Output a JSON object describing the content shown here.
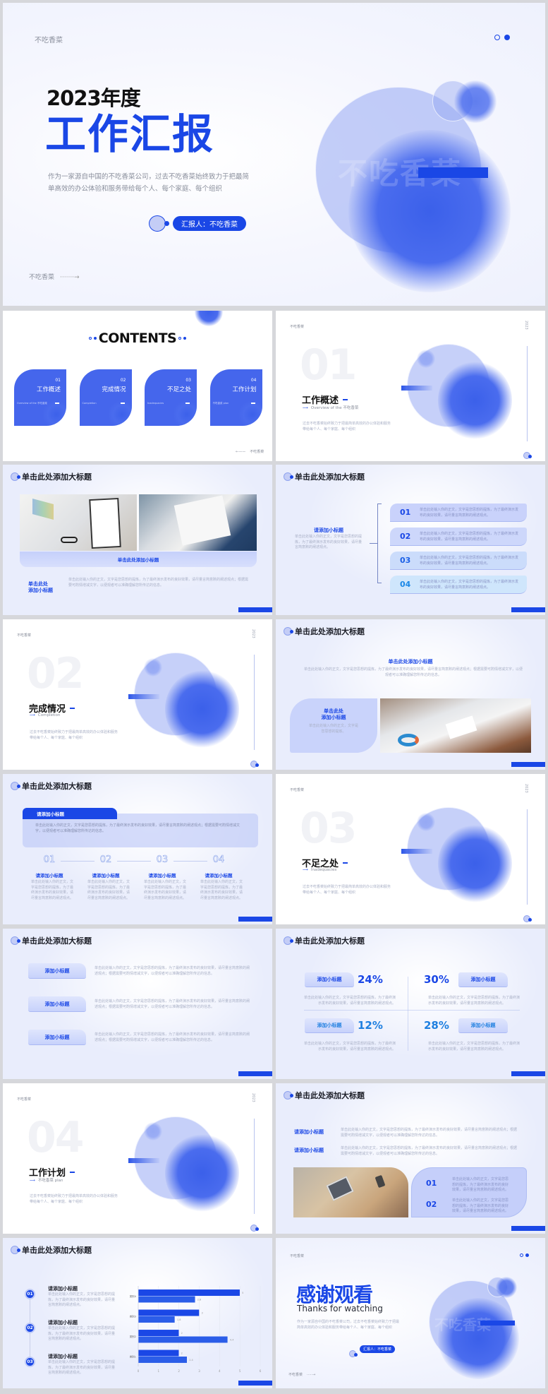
{
  "cover": {
    "brand": "不吃香菜",
    "year_title": "2023年度",
    "main_title": "工作汇报",
    "desc": "作为一家源自中国的不吃香菜公司，过去不吃香菜始终致力于把最简单高效的办公体验和服务带给每个人、每个家庭、每个组织",
    "reporter": "汇报人：不吃香菜",
    "footer_brand": "不吃香菜",
    "bg_text": "不吃香菜"
  },
  "common": {
    "slide_title": "单击此处添加大标题",
    "body": "单击此处输入你的正文，文字是您思想的提炼，为了最终演示发布的良好效果，请尽量言简意赅的阐述观点。",
    "body_long": "单击此处输入你的正文，文字是您思想的提炼，为了最终演示发布的良好效果，请尽量言简意赅的阐述观点；根据需要可酌情增减文字，以便观者可以准确理解您所传达的信息。",
    "year": "2023",
    "brand": "不吃香菜",
    "section_desc": "过去不吃香菜始终致力于把最简单高效的办公体验和服务带给每个人、每个家庭、每个组织",
    "accent": "#1a47e6"
  },
  "contents": {
    "title": "CONTENTS",
    "items": [
      {
        "num": "01",
        "label": "工作概述",
        "en": "Overview of the 不吃香菜"
      },
      {
        "num": "02",
        "label": "完成情况",
        "en": "Completion"
      },
      {
        "num": "03",
        "label": "不足之处",
        "en": "Inadequacies"
      },
      {
        "num": "04",
        "label": "工作计划",
        "en": "不吃香菜 plan"
      }
    ],
    "back": "不吃香菜"
  },
  "sections": [
    {
      "num": "01",
      "title": "工作概述",
      "en": "Overview of the 不吃香菜"
    },
    {
      "num": "02",
      "title": "完成情况",
      "en": "Completion"
    },
    {
      "num": "03",
      "title": "不足之处",
      "en": "Inadequacies"
    },
    {
      "num": "04",
      "title": "工作计划",
      "en": "不吃香菜 plan"
    }
  ],
  "photo_slide": {
    "band": "单击此处添加小标题",
    "label": "单击此处\n添加小标题"
  },
  "list_slide": {
    "subtitle": "请添加小标题",
    "nums": [
      "01",
      "02",
      "03",
      "04"
    ]
  },
  "image_text_slide": {
    "subtitle": "单击此处添加小标题",
    "label": "单击此处\n添加小标题",
    "caption": "单击此处输入你的正文，文字是您思想的提炼。"
  },
  "timeline_slide": {
    "tab": "请添加小标题",
    "steps": [
      {
        "num": "01",
        "title": "请添加小标题"
      },
      {
        "num": "02",
        "title": "请添加小标题"
      },
      {
        "num": "03",
        "title": "请添加小标题"
      },
      {
        "num": "04",
        "title": "请添加小标题"
      }
    ]
  },
  "labels_slide": {
    "items": [
      "添加小标题",
      "添加小标题",
      "添加小标题"
    ]
  },
  "percent_slide": {
    "items": [
      {
        "label": "添加小标题",
        "value": "24%"
      },
      {
        "label": "添加小标题",
        "value": "30%"
      },
      {
        "label": "添加小标题",
        "value": "12%"
      },
      {
        "label": "添加小标题",
        "value": "28%"
      }
    ]
  },
  "rows_slide": {
    "items": [
      "请添加小标题",
      "请添加小标题"
    ],
    "nums": [
      "01",
      "02"
    ]
  },
  "chart_slide": {
    "items": [
      {
        "num": "01",
        "title": "请添加小标题"
      },
      {
        "num": "02",
        "title": "请添加小标题"
      },
      {
        "num": "03",
        "title": "请添加小标题"
      }
    ]
  },
  "chart_data": {
    "type": "bar",
    "orientation": "horizontal",
    "categories": [
      "类别1",
      "类别2",
      "类别3",
      "类别4"
    ],
    "category_order": "bottom-to-top",
    "series": [
      {
        "values": [
          2,
          2,
          3,
          5
        ],
        "color": "#1a47e6"
      },
      {
        "values": [
          2.4,
          4.4,
          1.8,
          2.8
        ],
        "color": "#2b5de8"
      }
    ],
    "xlim": [
      0,
      6
    ],
    "xticks": [
      "0",
      "1",
      "2",
      "3",
      "4",
      "5",
      "6"
    ],
    "data_labels": true,
    "grid": true,
    "legend": "none"
  },
  "thanks": {
    "brand": "不吃香菜",
    "title": "感谢观看",
    "subtitle": "Thanks for watching",
    "desc": "作为一家源自中国的不吃香菜公司，过去不吃香菜始终致力于把最简单高效的办公体验和服务带给每个人、每个家庭、每个组织",
    "reporter": "汇报人：不吃香菜",
    "footer_brand": "不吃香菜",
    "bg_text": "不吃香菜"
  }
}
